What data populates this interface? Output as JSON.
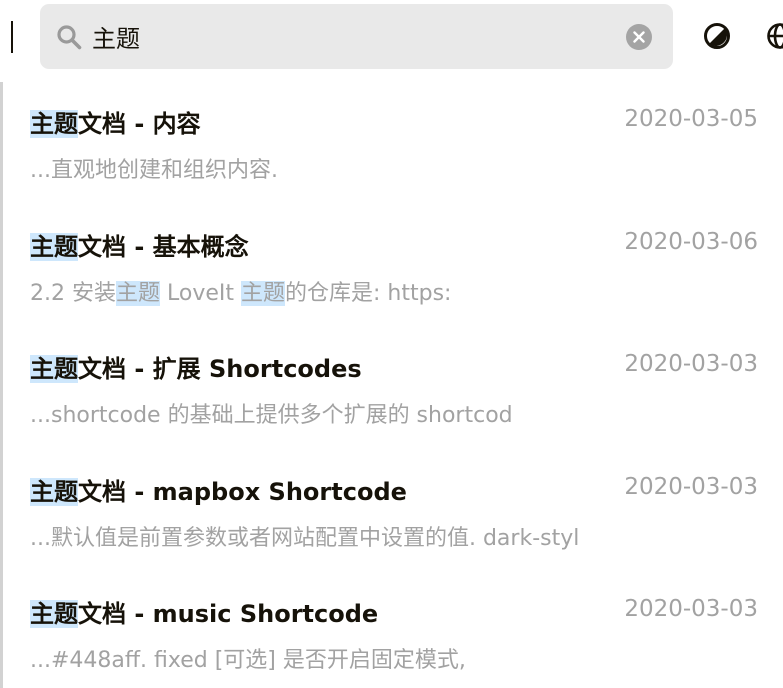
{
  "search": {
    "query": "主题",
    "icon": "search-icon",
    "clear_icon": "close-icon"
  },
  "toolbar": {
    "theme_icon": "theme-toggle-icon",
    "language_icon": "globe-icon"
  },
  "colors": {
    "highlight": "#cee7fc",
    "date_text": "#a2a2a2",
    "title_text": "#161209",
    "search_bg": "#e9e9e9"
  },
  "results": [
    {
      "title": [
        {
          "text": "主题",
          "hl": true
        },
        {
          "text": "文档 - 内容",
          "hl": false
        }
      ],
      "date": "2020-03-05",
      "snippet": [
        {
          "text": "...直观地创建和组织内容.",
          "hl": false
        }
      ]
    },
    {
      "title": [
        {
          "text": "主题",
          "hl": true
        },
        {
          "text": "文档 - 基本概念",
          "hl": false
        }
      ],
      "date": "2020-03-06",
      "snippet": [
        {
          "text": "2.2 安装",
          "hl": false
        },
        {
          "text": "主题",
          "hl": true
        },
        {
          "text": " LoveIt ",
          "hl": false
        },
        {
          "text": "主题",
          "hl": true
        },
        {
          "text": "的仓库是: https:",
          "hl": false
        }
      ]
    },
    {
      "title": [
        {
          "text": "主题",
          "hl": true
        },
        {
          "text": "文档 - 扩展 Shortcodes",
          "hl": false
        }
      ],
      "date": "2020-03-03",
      "snippet": [
        {
          "text": "...shortcode 的基础上提供多个扩展的 shortcod",
          "hl": false
        }
      ]
    },
    {
      "title": [
        {
          "text": "主题",
          "hl": true
        },
        {
          "text": "文档 - mapbox Shortcode",
          "hl": false
        }
      ],
      "date": "2020-03-03",
      "snippet": [
        {
          "text": "...默认值是前置参数或者网站配置中设置的值. dark-styl",
          "hl": false
        }
      ]
    },
    {
      "title": [
        {
          "text": "主题",
          "hl": true
        },
        {
          "text": "文档 - music Shortcode",
          "hl": false
        }
      ],
      "date": "2020-03-03",
      "snippet": [
        {
          "text": "...#448aff. fixed [可选] 是否开启固定模式,",
          "hl": false
        }
      ]
    }
  ]
}
